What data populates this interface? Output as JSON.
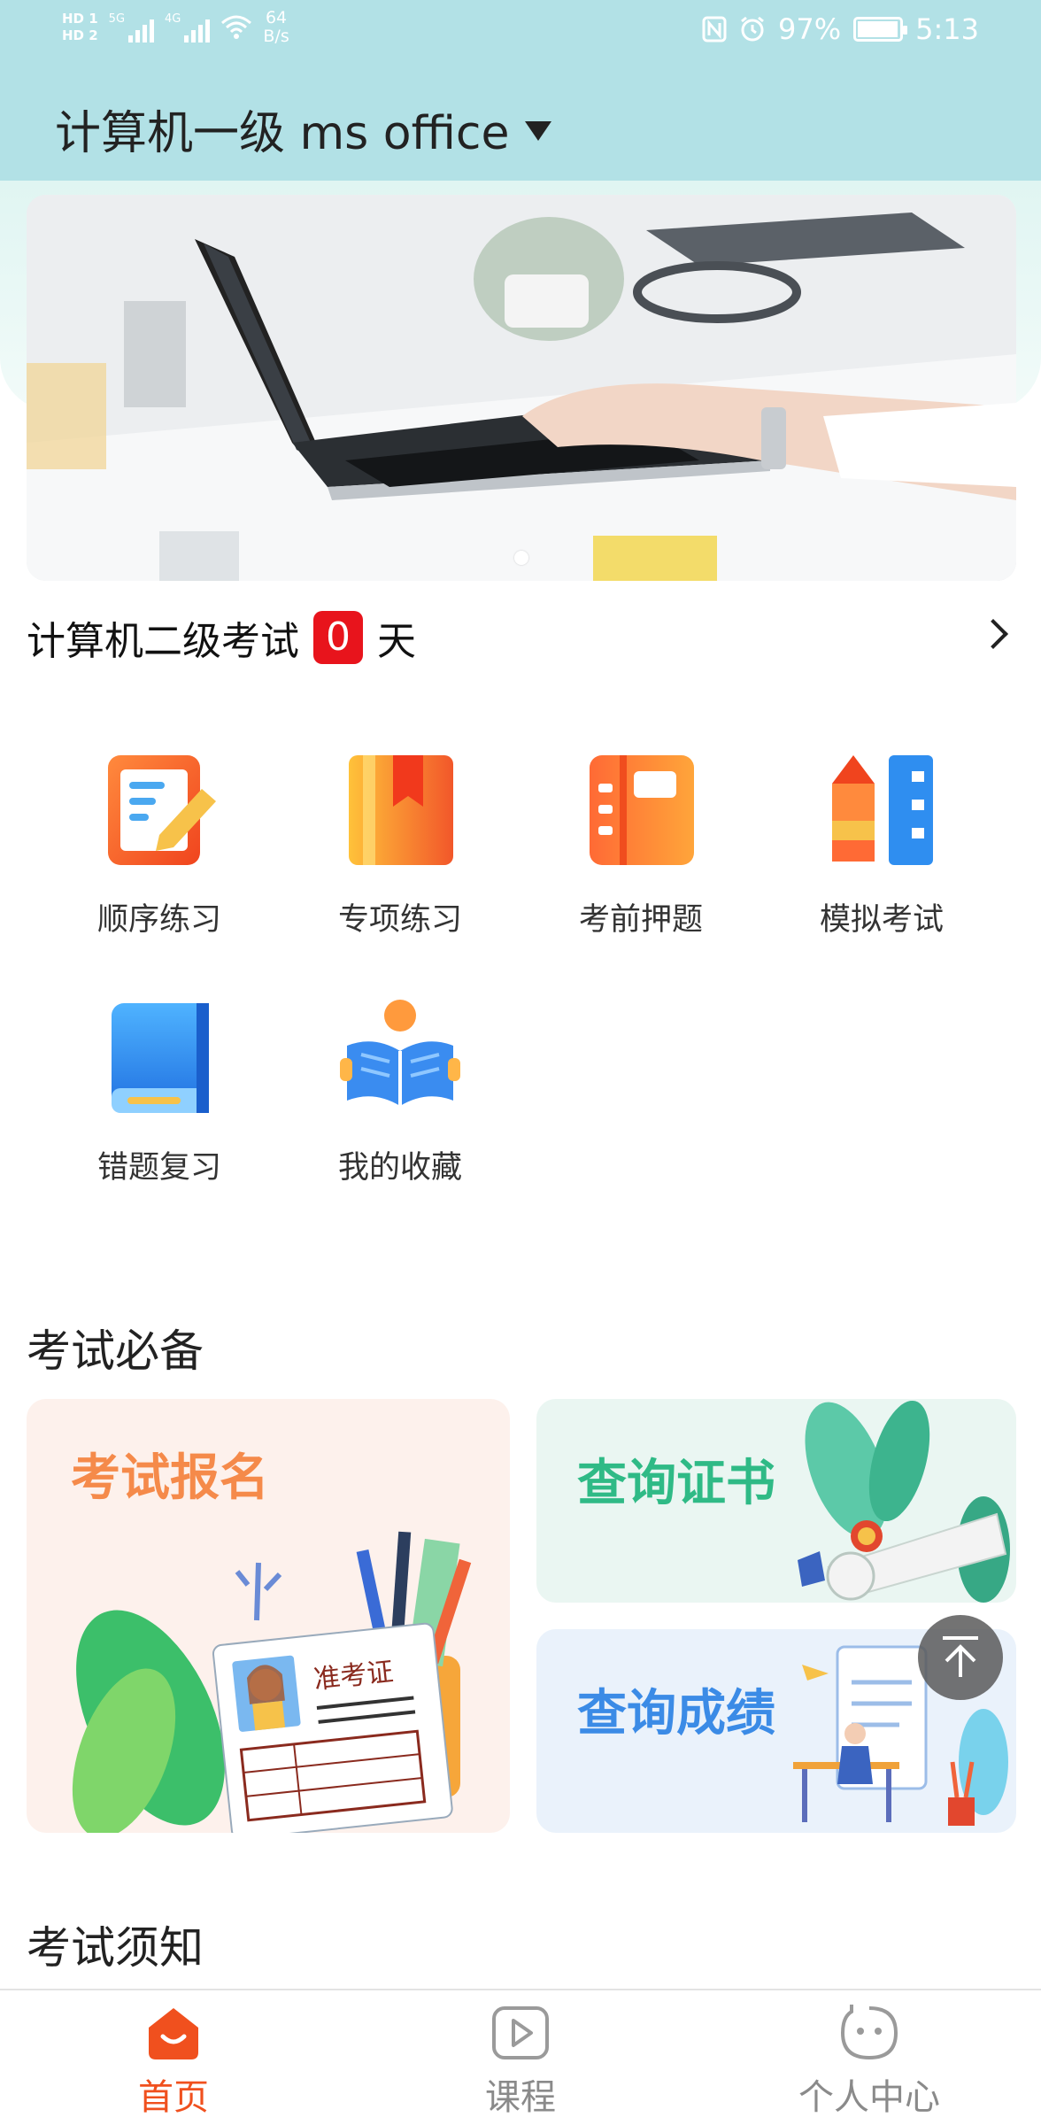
{
  "status_bar": {
    "hd1": "HD 1",
    "hd2": "HD 2",
    "sig1": "5G",
    "sig2": "4G",
    "speed_value": "64",
    "speed_unit": "B/s",
    "battery": "97%",
    "battery_level": 0.97,
    "time": "5:13"
  },
  "header": {
    "title": "计算机一级 ms office"
  },
  "banner": {
    "slides": 1,
    "active_slide": 1
  },
  "countdown": {
    "prefix": "计算机二级考试",
    "days": "0",
    "suffix": "天"
  },
  "functions": [
    {
      "label": "顺序练习",
      "icon": "list-edit-icon"
    },
    {
      "label": "专项练习",
      "icon": "bookmark-book-icon"
    },
    {
      "label": "考前押题",
      "icon": "notebook-icon"
    },
    {
      "label": "模拟考试",
      "icon": "pencil-ruler-icon"
    },
    {
      "label": "错题复习",
      "icon": "book-icon"
    },
    {
      "label": "我的收藏",
      "icon": "reading-person-icon"
    }
  ],
  "sections": {
    "exam_essentials": "考试必备",
    "exam_notice": "考试须知"
  },
  "cards": {
    "register": "考试报名",
    "register_badge": "准考证",
    "cert": "查询证书",
    "score": "查询成绩"
  },
  "bottom_nav": [
    {
      "label": "首页",
      "icon": "home-icon",
      "active": true
    },
    {
      "label": "课程",
      "icon": "play-icon",
      "active": false
    },
    {
      "label": "个人中心",
      "icon": "profile-icon",
      "active": false
    }
  ],
  "colors": {
    "header_bg": "#b2e1e6",
    "accent": "#f0501e",
    "countdown_badge": "#e8141c",
    "register_text": "#f58a4a",
    "cert_text": "#2fba86",
    "score_text": "#3b8be6"
  }
}
